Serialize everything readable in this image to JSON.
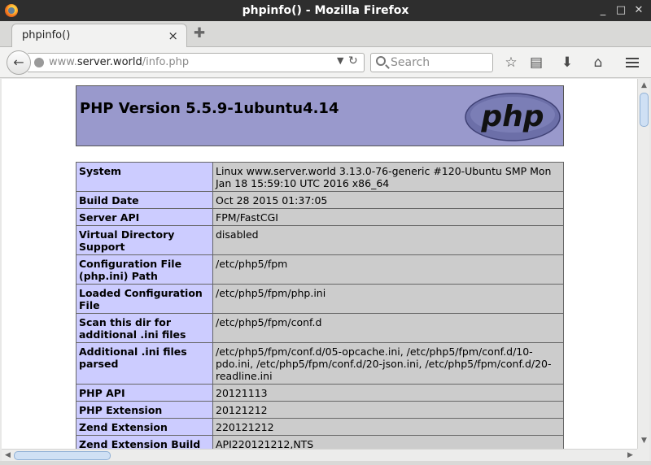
{
  "window": {
    "title": "phpinfo() - Mozilla Firefox"
  },
  "tabs": [
    {
      "label": "phpinfo()",
      "close_glyph": "×"
    }
  ],
  "nav": {
    "url_host_prefix": "www.",
    "url_host": "server.world",
    "url_path": "/info.php",
    "search_placeholder": "Search"
  },
  "page": {
    "heading": "PHP Version 5.5.9-1ubuntu4.14",
    "logo_text": "php",
    "rows": [
      {
        "key": "System",
        "value": "Linux www.server.world 3.13.0-76-generic #120-Ubuntu SMP Mon Jan 18 15:59:10 UTC 2016 x86_64"
      },
      {
        "key": "Build Date",
        "value": "Oct 28 2015 01:37:05"
      },
      {
        "key": "Server API",
        "value": "FPM/FastCGI"
      },
      {
        "key": "Virtual Directory Support",
        "value": "disabled"
      },
      {
        "key": "Configuration File (php.ini) Path",
        "value": "/etc/php5/fpm"
      },
      {
        "key": "Loaded Configuration File",
        "value": "/etc/php5/fpm/php.ini"
      },
      {
        "key": "Scan this dir for additional .ini files",
        "value": "/etc/php5/fpm/conf.d"
      },
      {
        "key": "Additional .ini files parsed",
        "value": "/etc/php5/fpm/conf.d/05-opcache.ini, /etc/php5/fpm/conf.d/10-pdo.ini, /etc/php5/fpm/conf.d/20-json.ini, /etc/php5/fpm/conf.d/20-readline.ini"
      },
      {
        "key": "PHP API",
        "value": "20121113"
      },
      {
        "key": "PHP Extension",
        "value": "20121212"
      },
      {
        "key": "Zend Extension",
        "value": "220121212"
      },
      {
        "key": "Zend Extension Build",
        "value": "API220121212,NTS"
      }
    ]
  },
  "colors": {
    "header_bg": "#9999cc",
    "key_bg": "#ccccff",
    "value_bg": "#cccccc"
  }
}
